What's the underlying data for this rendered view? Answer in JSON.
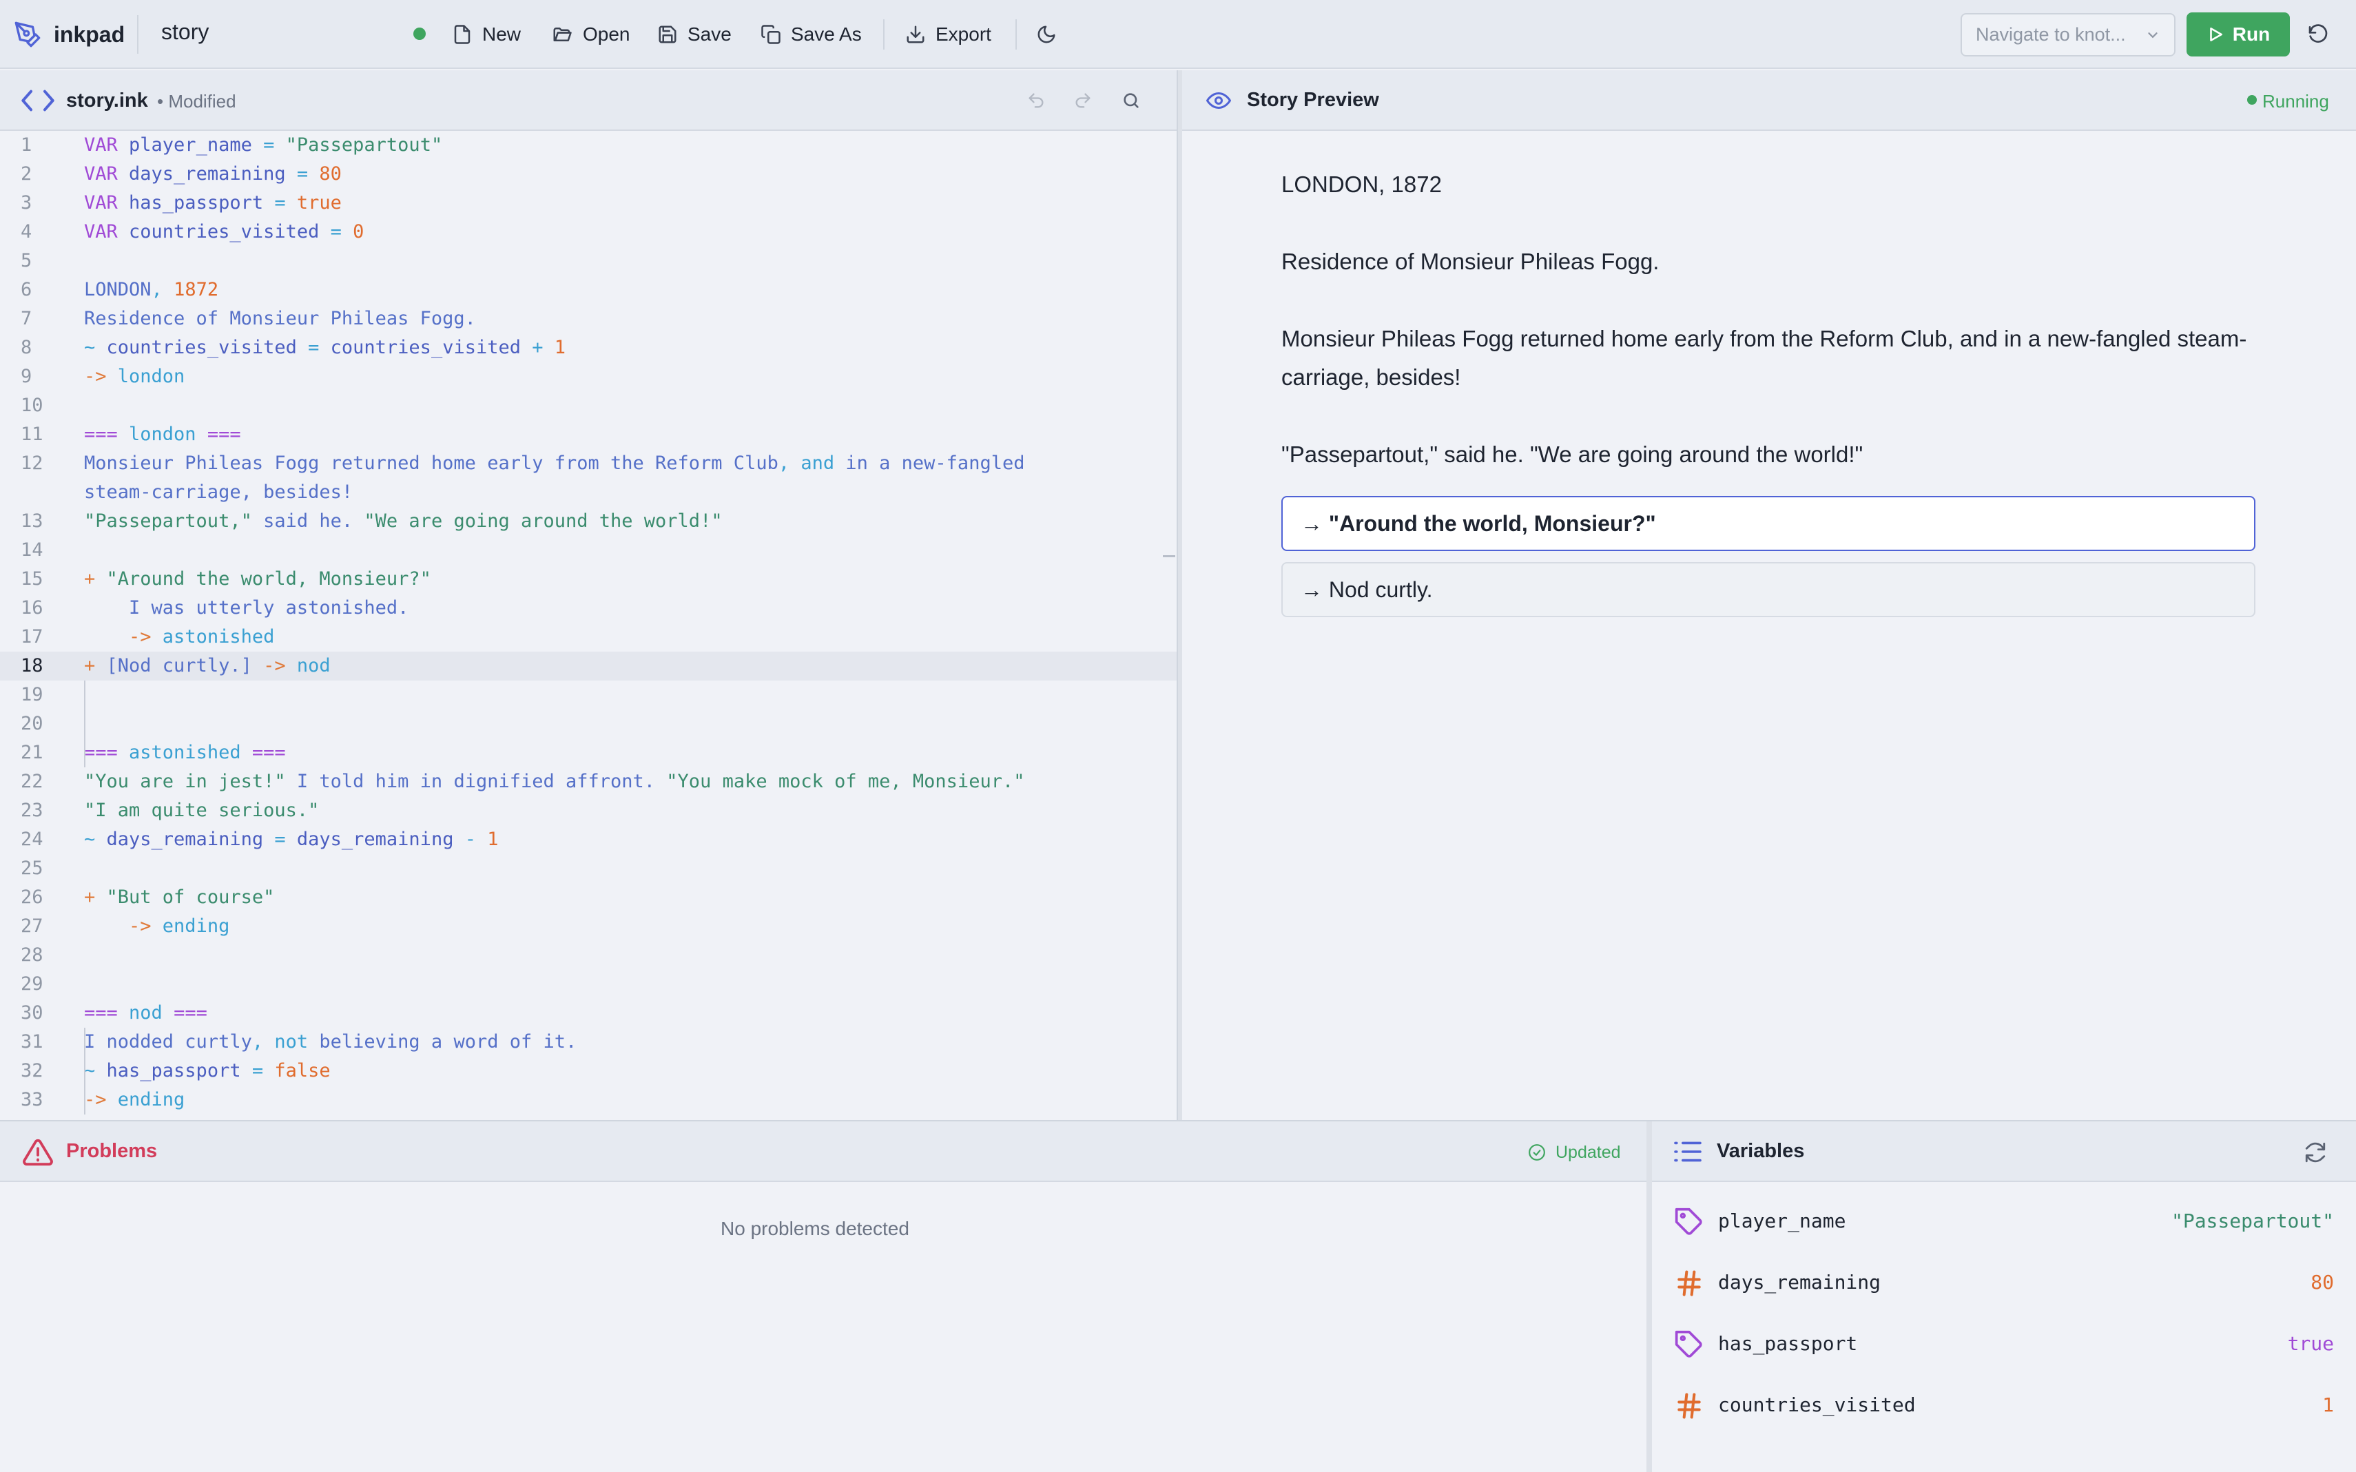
{
  "app": {
    "name": "inkpad",
    "document": "story"
  },
  "toolbar": {
    "new_label": "New",
    "open_label": "Open",
    "save_label": "Save",
    "save_as_label": "Save As",
    "export_label": "Export",
    "navigate_placeholder": "Navigate to knot...",
    "run_label": "Run"
  },
  "editor": {
    "filename": "story.ink",
    "status": "• Modified",
    "active_line": 18,
    "lines": [
      {
        "n": "1",
        "tokens": [
          [
            "kw",
            "VAR "
          ],
          [
            "varn",
            "player_name"
          ],
          [
            "op",
            " = "
          ],
          [
            "str",
            "\"Passepartout\""
          ]
        ]
      },
      {
        "n": "2",
        "tokens": [
          [
            "kw",
            "VAR "
          ],
          [
            "varn",
            "days_remaining"
          ],
          [
            "op",
            " = "
          ],
          [
            "num",
            "80"
          ]
        ]
      },
      {
        "n": "3",
        "tokens": [
          [
            "kw",
            "VAR "
          ],
          [
            "varn",
            "has_passport"
          ],
          [
            "op",
            " = "
          ],
          [
            "num",
            "true"
          ]
        ]
      },
      {
        "n": "4",
        "tokens": [
          [
            "kw",
            "VAR "
          ],
          [
            "varn",
            "countries_visited"
          ],
          [
            "op",
            " = "
          ],
          [
            "num",
            "0"
          ]
        ]
      },
      {
        "n": "5",
        "tokens": []
      },
      {
        "n": "6",
        "tokens": [
          [
            "plain",
            "LONDON"
          ],
          [
            "op",
            ", "
          ],
          [
            "num",
            "1872"
          ]
        ]
      },
      {
        "n": "7",
        "tokens": [
          [
            "plain",
            "Residence of Monsieur Phileas Fogg."
          ]
        ]
      },
      {
        "n": "8",
        "tokens": [
          [
            "op",
            "~ "
          ],
          [
            "varn",
            "countries_visited"
          ],
          [
            "op",
            " = "
          ],
          [
            "varn",
            "countries_visited"
          ],
          [
            "op",
            " + "
          ],
          [
            "num",
            "1"
          ]
        ]
      },
      {
        "n": "9",
        "tokens": [
          [
            "arrow",
            "-> "
          ],
          [
            "knotname",
            "london"
          ]
        ]
      },
      {
        "n": "10",
        "tokens": []
      },
      {
        "n": "11",
        "tokens": [
          [
            "knot",
            "=== "
          ],
          [
            "knotname",
            "london"
          ],
          [
            "knot",
            " ==="
          ]
        ]
      },
      {
        "n": "12",
        "tokens": [
          [
            "plain",
            "Monsieur Phileas Fogg returned home early from the Reform Club"
          ],
          [
            "op",
            ", and"
          ],
          [
            "plain",
            " in a new-fangled"
          ]
        ]
      },
      {
        "n": "",
        "tokens": [
          [
            "plain",
            "steam-carriage, besides!"
          ]
        ]
      },
      {
        "n": "13",
        "tokens": [
          [
            "str",
            "\"Passepartout,\""
          ],
          [
            "plain",
            " said he. "
          ],
          [
            "str",
            "\"We are going around the world!\""
          ]
        ]
      },
      {
        "n": "14",
        "tokens": []
      },
      {
        "n": "15",
        "tokens": [
          [
            "arrow",
            "+ "
          ],
          [
            "str",
            "\"Around the world, Monsieur?\""
          ]
        ]
      },
      {
        "n": "16",
        "tokens": [
          [
            "plain",
            "    I was utterly astonished."
          ]
        ]
      },
      {
        "n": "17",
        "tokens": [
          [
            "arrow",
            "    -> "
          ],
          [
            "knotname",
            "astonished"
          ]
        ]
      },
      {
        "n": "18",
        "tokens": [
          [
            "arrow",
            "+ "
          ],
          [
            "plain",
            "[Nod curtly.]"
          ],
          [
            "arrow",
            " -> "
          ],
          [
            "knotname",
            "nod"
          ]
        ]
      },
      {
        "n": "19",
        "tokens": []
      },
      {
        "n": "20",
        "tokens": []
      },
      {
        "n": "21",
        "tokens": [
          [
            "knot",
            "=== "
          ],
          [
            "knotname",
            "astonished"
          ],
          [
            "knot",
            " ==="
          ]
        ]
      },
      {
        "n": "22",
        "tokens": [
          [
            "str",
            "\"You are in jest!\""
          ],
          [
            "plain",
            " I told him in dignified affront. "
          ],
          [
            "str",
            "\"You make mock of me, Monsieur.\""
          ]
        ]
      },
      {
        "n": "23",
        "tokens": [
          [
            "str",
            "\"I am quite serious.\""
          ]
        ]
      },
      {
        "n": "24",
        "tokens": [
          [
            "op",
            "~ "
          ],
          [
            "varn",
            "days_remaining"
          ],
          [
            "op",
            " = "
          ],
          [
            "varn",
            "days_remaining"
          ],
          [
            "op",
            " - "
          ],
          [
            "num",
            "1"
          ]
        ]
      },
      {
        "n": "25",
        "tokens": []
      },
      {
        "n": "26",
        "tokens": [
          [
            "arrow",
            "+ "
          ],
          [
            "str",
            "\"But of course\""
          ]
        ]
      },
      {
        "n": "27",
        "tokens": [
          [
            "arrow",
            "    -> "
          ],
          [
            "knotname",
            "ending"
          ]
        ]
      },
      {
        "n": "28",
        "tokens": []
      },
      {
        "n": "29",
        "tokens": []
      },
      {
        "n": "30",
        "tokens": [
          [
            "knot",
            "=== "
          ],
          [
            "knotname",
            "nod"
          ],
          [
            "knot",
            " ==="
          ]
        ]
      },
      {
        "n": "31",
        "tokens": [
          [
            "plain",
            "I nodded curtly"
          ],
          [
            "op",
            ", not"
          ],
          [
            "plain",
            " believing a word of it."
          ]
        ]
      },
      {
        "n": "32",
        "tokens": [
          [
            "op",
            "~ "
          ],
          [
            "varn",
            "has_passport"
          ],
          [
            "op",
            " = "
          ],
          [
            "num",
            "false"
          ]
        ]
      },
      {
        "n": "33",
        "tokens": [
          [
            "arrow",
            "-> "
          ],
          [
            "knotname",
            "ending"
          ]
        ]
      }
    ]
  },
  "preview": {
    "title": "Story Preview",
    "status": "Running",
    "paragraphs": [
      "LONDON, 1872",
      "Residence of Monsieur Phileas Fogg.",
      "Monsieur Phileas Fogg returned home early from the Reform Club, and in a new-fangled steam-carriage, besides!",
      "\"Passepartout,\" said he. \"We are going around the world!\""
    ],
    "choices": [
      "→ \"Around the world, Monsieur?\"",
      "→ Nod curtly."
    ]
  },
  "problems": {
    "title": "Problems",
    "status": "Updated",
    "empty_message": "No problems detected"
  },
  "variables": {
    "title": "Variables",
    "items": [
      {
        "icon": "tag-icon",
        "name": "player_name",
        "value": "\"Passepartout\"",
        "color": "#3b8c6e"
      },
      {
        "icon": "hash-icon",
        "name": "days_remaining",
        "value": "80",
        "color": "#e06c2e"
      },
      {
        "icon": "tag-icon",
        "name": "has_passport",
        "value": "true",
        "color": "#a04ad6"
      },
      {
        "icon": "hash-icon",
        "name": "countries_visited",
        "value": "1",
        "color": "#e06c2e"
      }
    ]
  },
  "colors": {
    "accent": "#5063d6",
    "run": "#3fa55f",
    "error": "#d23c5a"
  }
}
